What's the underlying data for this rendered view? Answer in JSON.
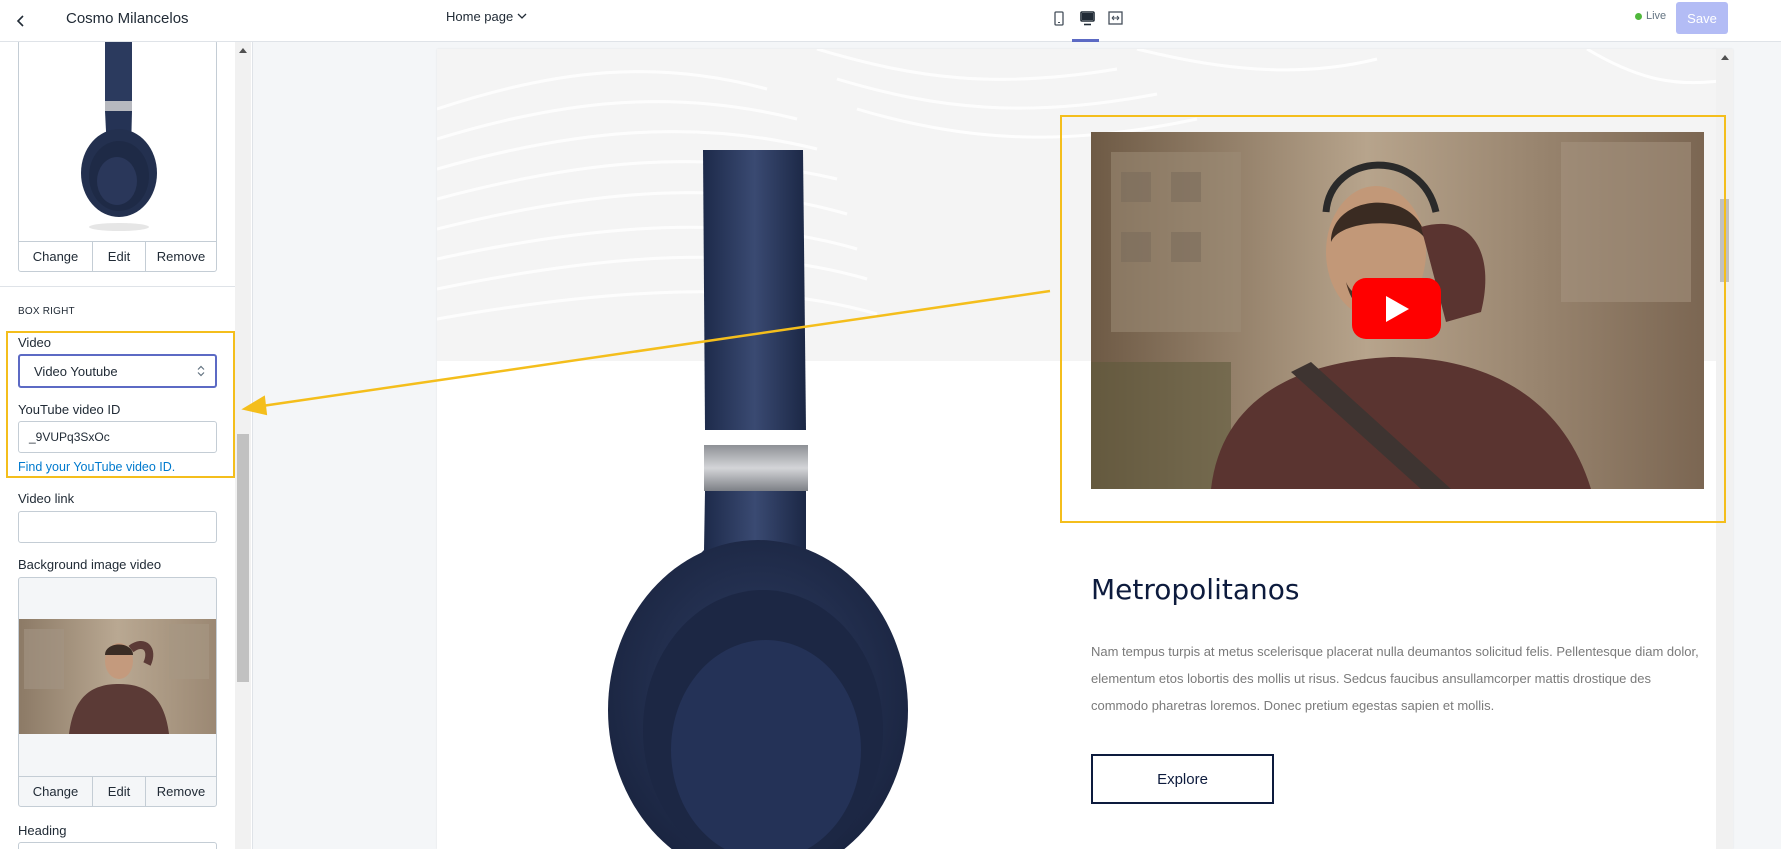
{
  "header": {
    "back_label": "Back",
    "shop_name": "Cosmo Milancelos"
  },
  "top_image_actions": {
    "change": "Change",
    "edit": "Edit",
    "remove": "Remove"
  },
  "box_right": {
    "section_title": "BOX RIGHT",
    "video_label": "Video",
    "video_select_value": "Video Youtube",
    "youtube_id_label": "YouTube video ID",
    "youtube_id_value": "_9VUPq3SxOc",
    "help_link": "Find your YouTube video ID.",
    "video_link_label": "Video link",
    "video_link_value": "",
    "bg_image_label": "Background image video",
    "bg_image_actions": {
      "change": "Change",
      "edit": "Edit",
      "remove": "Remove"
    },
    "heading_label": "Heading"
  },
  "topbar": {
    "page_select": "Home page",
    "devices": [
      "mobile-icon",
      "desktop-icon",
      "fullscreen-icon"
    ],
    "active_device": "desktop-icon",
    "status": "Live",
    "save_label": "Save"
  },
  "preview": {
    "product_heading": "Metropolitanos",
    "product_text": "Nam tempus turpis at metus scelerisque placerat nulla deumantos solicitud felis. Pellentesque diam dolor, elementum etos lobortis des mollis ut risus. Sedcus faucibus ansullamcorper mattis drostique des commodo pharetras loremos. Donec pretium egestas sapien et mollis.",
    "explore_label": "Explore"
  },
  "colors": {
    "highlight": "#f4be1c",
    "accent": "#5c6ac4",
    "save_disabled": "#b3bcf5",
    "link": "#007ace",
    "live_dot": "#50b83c",
    "youtube_red": "#ff0000",
    "navy": "#0d1b3d"
  }
}
